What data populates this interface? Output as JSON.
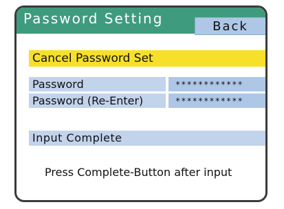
{
  "screen": {
    "title": "Password Setting",
    "back_label": "Back"
  },
  "actions": {
    "cancel_label": "Cancel Password Set",
    "complete_label": "Input Complete"
  },
  "fields": [
    {
      "label": "Password",
      "value": "************"
    },
    {
      "label": "Password (Re-Enter)",
      "value": "************"
    }
  ],
  "instruction": "Press Complete-Button after input",
  "colors": {
    "title_bar": "#3f9b7e",
    "button_blue": "#aec7e6",
    "label_blue": "#c2d3ec",
    "cancel_yellow": "#f7e02a",
    "frame_border": "#3a3a3a"
  }
}
